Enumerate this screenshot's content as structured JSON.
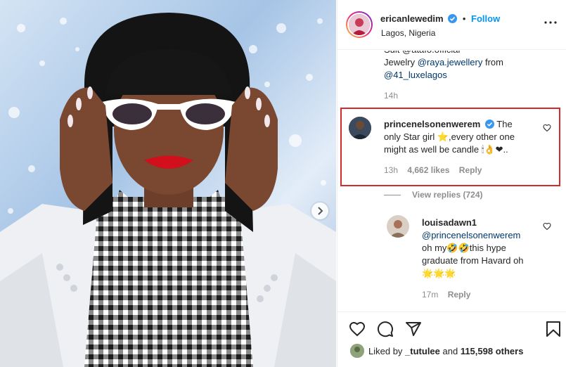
{
  "post": {
    "username": "ericanlewedim",
    "follow_label": "Follow",
    "location": "Lagos, Nigeria",
    "bullet": "•"
  },
  "caption": {
    "line1": "Suit @atafo.official",
    "line2_prefix": "Jewelry ",
    "line2_mention": "@raya.jewellery",
    "line2_suffix": " from",
    "line3_mention": "@41_luxelagos",
    "time": "14h"
  },
  "highlighted_comment": {
    "username": "princenelsonenwerem",
    "text_a": "The",
    "text_b": "only Star girl ⭐,every other one",
    "text_c": "might as well be candle 🕯👌❤..",
    "time": "13h",
    "likes": "4,662 likes",
    "reply_label": "Reply",
    "view_replies": "View replies (724)"
  },
  "reply_comment": {
    "username": "louisadawn1",
    "mention": "@princenelsonenwerem",
    "line2": "oh my🤣🤣this hype",
    "line3": "graduate from Havard oh",
    "line4": "🌟🌟🌟",
    "time": "17m",
    "reply_label": "Reply"
  },
  "footer": {
    "liked_prefix": "Liked by ",
    "liked_user": "_tutulee",
    "liked_mid": " and ",
    "liked_count": "115,598 others"
  },
  "colors": {
    "accent": "#0095f6",
    "highlight_border": "#d42a2a",
    "verified": "#3897f0"
  }
}
